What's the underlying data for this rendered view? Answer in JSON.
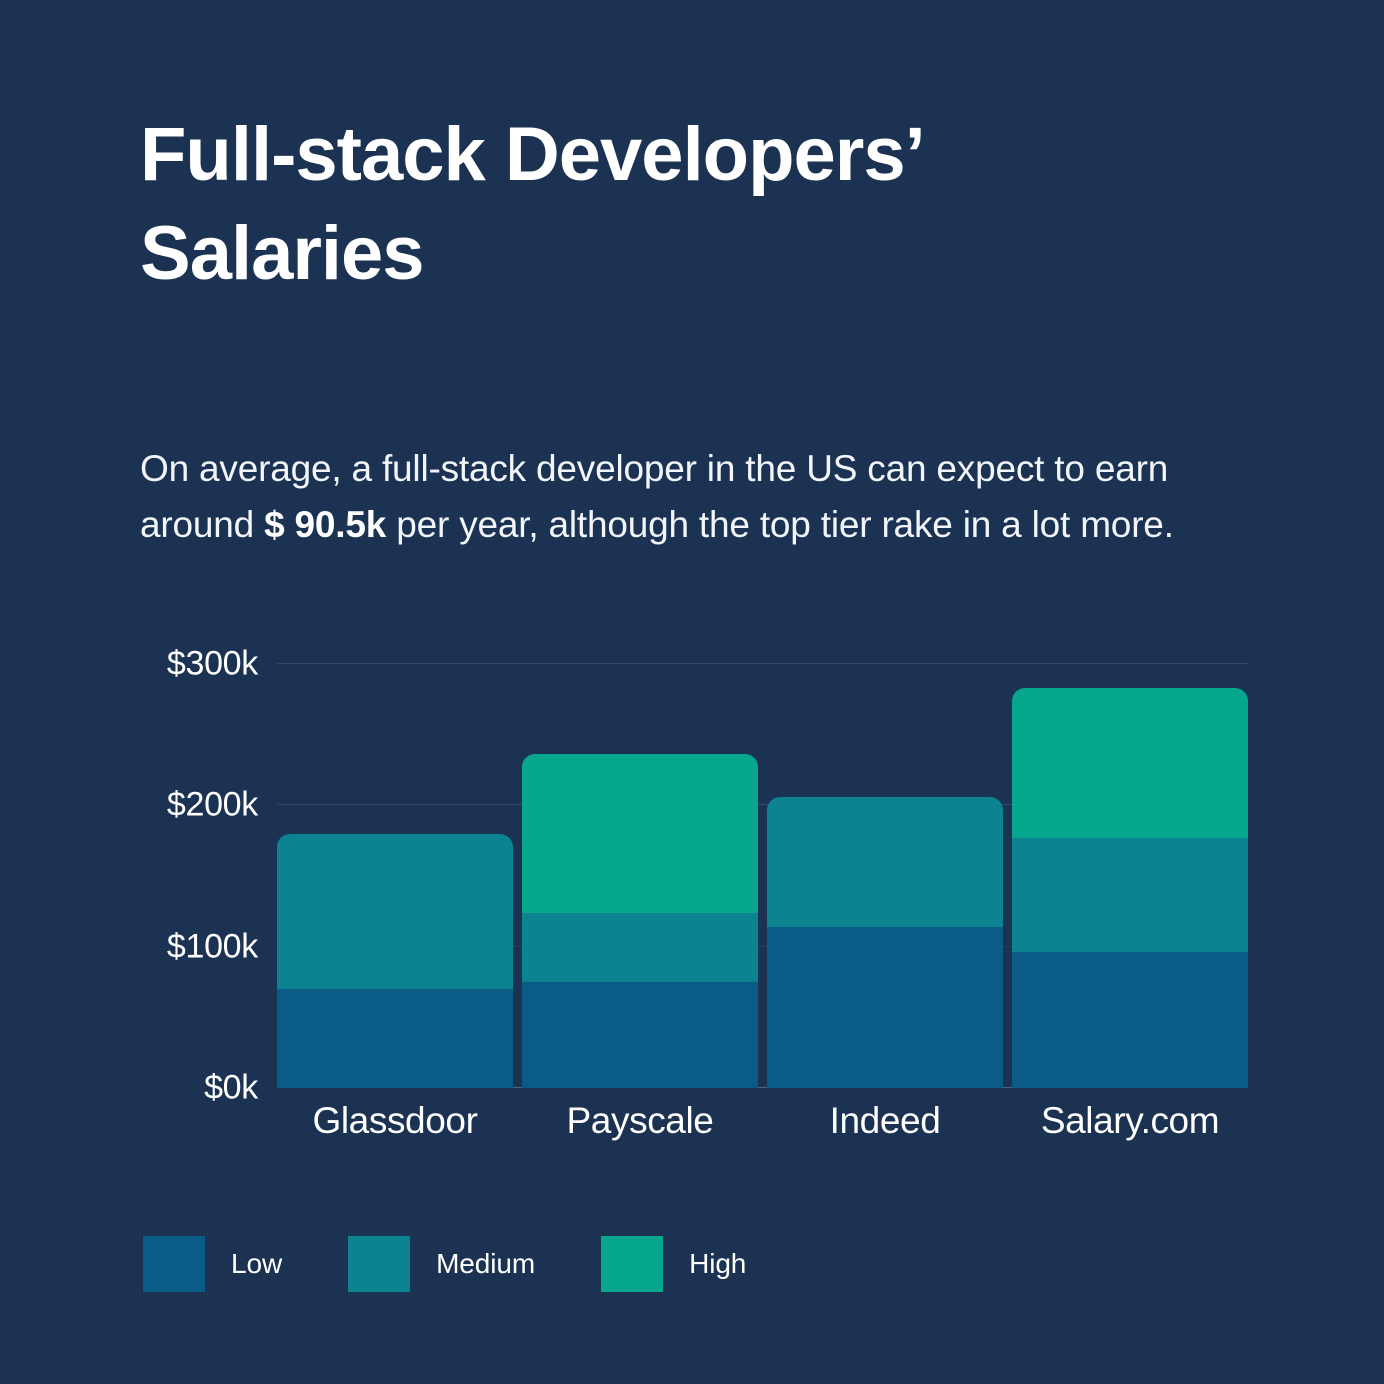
{
  "theme": {
    "background": "#1b3253",
    "text": "#ffffff",
    "gridline": "#36496a",
    "baseline": "#51637f"
  },
  "header": {
    "title": "Full-stack Developers’\nSalaries",
    "subtitle_part1": "On average, a full-stack developer in the US can expect to earn around ",
    "subtitle_highlight": "$ 90.5k",
    "subtitle_part2": " per year, although the top tier rake in a lot more."
  },
  "legend": {
    "items": [
      {
        "label": "Low",
        "color": "#0a5b85"
      },
      {
        "label": "Medium",
        "color": "#0b8391"
      },
      {
        "label": "High",
        "color": "#07a78d"
      }
    ]
  },
  "chart_data": {
    "type": "bar",
    "subtype": "stacked",
    "title": "Full-stack Developers’ Salaries",
    "xlabel": "",
    "ylabel": "",
    "categories": [
      "Glassdoor",
      "Payscale",
      "Indeed",
      "Salary.com"
    ],
    "series": [
      {
        "name": "Low",
        "color": "#0a5b85",
        "values": [
          70,
          75,
          114,
          96
        ]
      },
      {
        "name": "Medium",
        "color": "#0b8391",
        "values": [
          110,
          49,
          92,
          81
        ]
      },
      {
        "name": "High",
        "color": "#07a78d",
        "values": [
          0,
          112,
          0,
          106
        ]
      }
    ],
    "totals": [
      180,
      236,
      206,
      283
    ],
    "units": "thousands of USD per year",
    "ylim": [
      0,
      300
    ],
    "yticks": [
      0,
      100,
      200,
      300
    ],
    "ytick_labels": [
      "$0k",
      "$100k",
      "$200k",
      "$300k"
    ],
    "grid": true,
    "legend_position": "bottom-left"
  }
}
